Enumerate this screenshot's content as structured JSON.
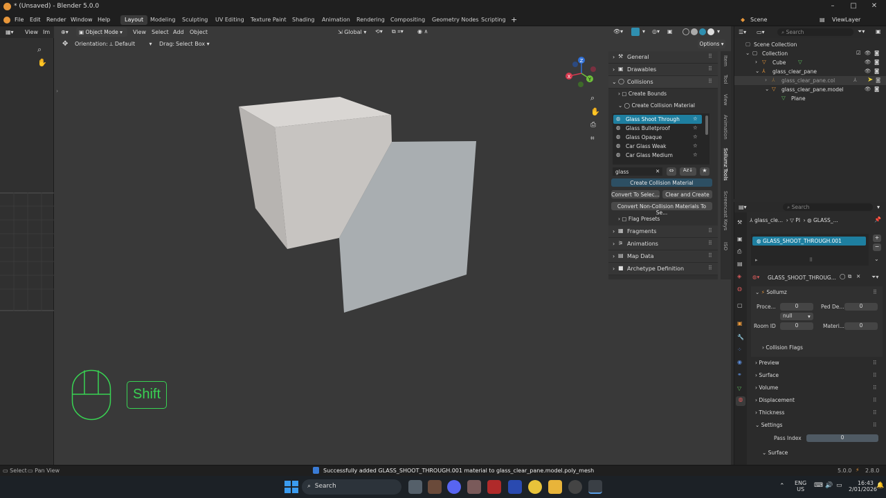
{
  "title_bar": {
    "title": "* (Unsaved) - Blender 5.0.0"
  },
  "menu": {
    "items": [
      "File",
      "Edit",
      "Render",
      "Window",
      "Help"
    ]
  },
  "workspaces": {
    "tabs": [
      "Layout",
      "Modeling",
      "Sculpting",
      "UV Editing",
      "Texture Paint",
      "Shading",
      "Animation",
      "Rendering",
      "Compositing",
      "Geometry Nodes",
      "Scripting"
    ],
    "active": "Layout"
  },
  "topbar_right": {
    "scene": "Scene",
    "view_layer": "ViewLayer"
  },
  "left_editor": {
    "view": "View",
    "image": "Im"
  },
  "viewport": {
    "mode": "Object Mode",
    "menus": [
      "View",
      "Select",
      "Add",
      "Object"
    ],
    "transform_orientation": "Global",
    "orientation_label": "Orientation:",
    "orientation_value": "Default",
    "drag_label": "Drag:",
    "drag_value": "Select Box",
    "options": "Options",
    "gizmo_axes": [
      "Z",
      "Y",
      "X"
    ],
    "overlay_keys": {
      "key": "Shift"
    }
  },
  "sidebar_tabs": [
    "Item",
    "Tool",
    "View",
    "Animation",
    "Sollumz Tools",
    "Screencast Keys",
    "ISO"
  ],
  "sollumz_panel": {
    "sections": [
      "General",
      "Drawables",
      "Collisions"
    ],
    "create_bounds": "Create Bounds",
    "create_collision_material": "Create Collision Material",
    "materials": [
      "Glass Shoot Through",
      "Glass Bulletproof",
      "Glass Opaque",
      "Car Glass Weak",
      "Car Glass Medium"
    ],
    "selected_material": "Glass Shoot Through",
    "filter_value": "glass",
    "btn_create": "Create Collision Material",
    "btn_convert_selected": "Convert To Selec...",
    "btn_clear_create": "Clear and Create ...",
    "btn_convert_non": "Convert Non-Collision Materials To Se...",
    "flag_presets": "Flag Presets",
    "more_sections": [
      "Fragments",
      "Animations",
      "Map Data",
      "Archetype Definition"
    ]
  },
  "outliner": {
    "search_placeholder": "Search",
    "rows": [
      {
        "label": "Scene Collection",
        "indent": 0
      },
      {
        "label": "Collection",
        "indent": 1
      },
      {
        "label": "Cube",
        "indent": 2
      },
      {
        "label": "glass_clear_pane",
        "indent": 2
      },
      {
        "label": "glass_clear_pane.col",
        "indent": 3
      },
      {
        "label": "glass_clear_pane.model",
        "indent": 3
      },
      {
        "label": "Plane",
        "indent": 4
      }
    ]
  },
  "properties": {
    "search_placeholder": "Search",
    "breadcrumb": [
      "glass_cle...",
      "Pl",
      "GLASS_..."
    ],
    "material_slot": "GLASS_SHOOT_THROUGH.001",
    "material_name": "GLASS_SHOOT_THROUG...",
    "sollumz": "Sollumz",
    "fields": [
      {
        "label": "Proce...",
        "value": "0"
      },
      {
        "label": "Ped De...",
        "value": "0"
      },
      {
        "label": "Room ID",
        "value": "0"
      },
      {
        "label": "Materi...",
        "value": "0"
      }
    ],
    "null_select": "null",
    "collision_flags": "Collision Flags",
    "sections": [
      "Preview",
      "Surface",
      "Volume",
      "Displacement",
      "Thickness",
      "Settings"
    ],
    "pass_index_label": "Pass Index",
    "pass_index_value": "0",
    "sub_surface": "Surface"
  },
  "status_bar": {
    "left": [
      "Select",
      "Pan View"
    ],
    "message": "Successfully added GLASS_SHOOT_THROUGH.001 material to glass_clear_pane.model.poly_mesh",
    "version": "5.0.0",
    "addon_version": "2.8.0"
  },
  "taskbar": {
    "search": "Search",
    "lang": "ENG",
    "region": "US",
    "time": "16:43",
    "date": "2/01/2026"
  },
  "colors": {
    "accent_blue": "#2f8fb0",
    "selected": "#1e7fa0",
    "green_overlay": "#39d353",
    "orange_icon": "#e8973a"
  }
}
